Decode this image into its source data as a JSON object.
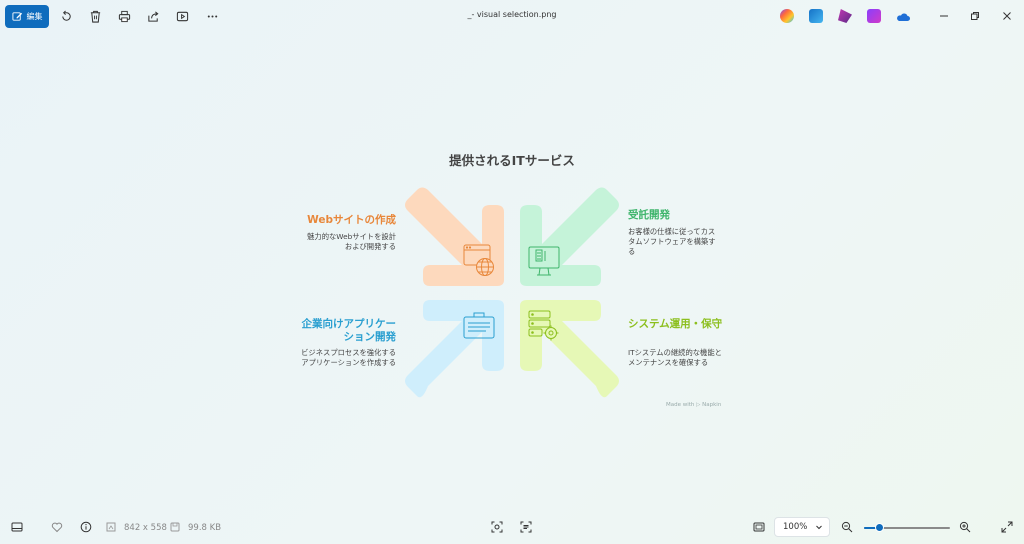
{
  "toolbar": {
    "edit_label": "編集",
    "icons": [
      "rotate-icon",
      "delete-icon",
      "print-icon",
      "share-icon",
      "slideshow-icon",
      "more-icon"
    ]
  },
  "window": {
    "title": "_- visual selection.png"
  },
  "diagram": {
    "title": "提供されるITサービス",
    "items": [
      {
        "title": "Webサイトの作成",
        "desc": "魅力的なWebサイトを設計および開発する",
        "color": "#e8873a"
      },
      {
        "title": "受託開発",
        "desc": "お客様の仕様に従ってカスタムソフトウェアを構築する",
        "color": "#3fb56c"
      },
      {
        "title": "企業向けアプリケーション開発",
        "desc": "ビジネスプロセスを強化するアプリケーションを作成する",
        "color": "#2a9fd0"
      },
      {
        "title": "システム運用・保守",
        "desc": "ITシステムの継続的な機能とメンテナンスを確保する",
        "color": "#8cbf1e"
      }
    ],
    "made_with": "Made with ▷ Napkin"
  },
  "status": {
    "dimensions": "842 x 558",
    "filesize": "99.8 KB",
    "zoom": "100%",
    "zoom_level": 0.18
  },
  "colors": {
    "accent": "#0f6cbd"
  }
}
